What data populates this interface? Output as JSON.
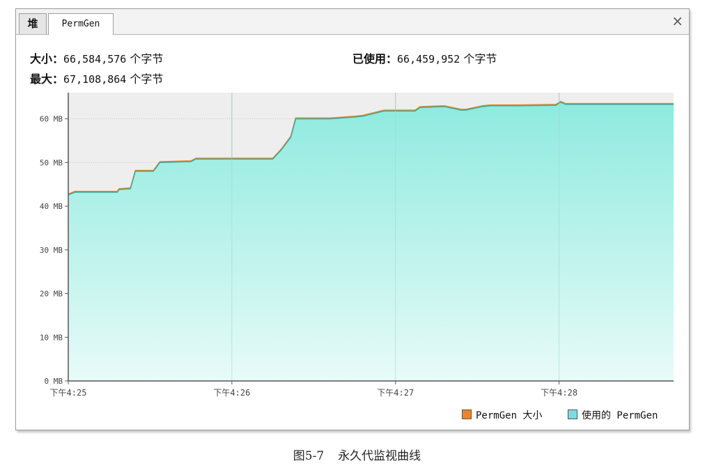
{
  "tabs": [
    {
      "label": "堆",
      "active": false
    },
    {
      "label": "PermGen",
      "active": true
    }
  ],
  "close_label": "×",
  "stats": {
    "size_label": "大小：",
    "size_value": "66,584,576",
    "max_label": "最大：",
    "max_value": "67,108,864",
    "used_label": "已使用：",
    "used_value": "66,459,952",
    "unit": "个字节"
  },
  "chart_data": {
    "type": "area",
    "colors": {
      "size": "#e8862a",
      "used": "#8eeadf",
      "plot_bg": "#eeeeee"
    },
    "y_ticks": [
      "0 MB",
      "10 MB",
      "20 MB",
      "30 MB",
      "40 MB",
      "50 MB",
      "60 MB"
    ],
    "y_tick_values": [
      0,
      10,
      20,
      30,
      40,
      50,
      60
    ],
    "ylim": [
      0,
      66
    ],
    "x_ticks": [
      "下午4:25",
      "下午4:26",
      "下午4:27",
      "下午4:28"
    ],
    "x_tick_values": [
      0,
      1,
      2,
      3
    ],
    "xlim": [
      0,
      3.7
    ],
    "grid": true,
    "series": [
      {
        "name": "PermGen 大小",
        "color": "#e8862a",
        "x": [
          0,
          0.04,
          0.3,
          0.31,
          0.38,
          0.41,
          0.52,
          0.56,
          0.75,
          0.78,
          1.02,
          1.25,
          1.3,
          1.33,
          1.36,
          1.39,
          1.6,
          1.75,
          1.8,
          1.93,
          2.12,
          2.15,
          2.3,
          2.4,
          2.43,
          2.53,
          2.58,
          2.75,
          2.98,
          3.01,
          3.04,
          3.7
        ],
        "y": [
          42.8,
          43.4,
          43.4,
          44,
          44.2,
          48.2,
          48.2,
          50.2,
          50.4,
          51,
          51,
          51,
          53,
          54.5,
          56,
          60.2,
          60.2,
          60.6,
          60.8,
          62,
          62,
          62.8,
          63,
          62.2,
          62.2,
          63,
          63.2,
          63.2,
          63.3,
          64,
          63.5,
          63.5
        ]
      },
      {
        "name": "使用的 PermGen",
        "color": "#8eeadf",
        "x": [
          0,
          0.04,
          0.3,
          0.31,
          0.38,
          0.41,
          0.52,
          0.56,
          0.75,
          0.78,
          1.02,
          1.25,
          1.3,
          1.33,
          1.36,
          1.39,
          1.6,
          1.75,
          1.8,
          1.93,
          2.12,
          2.15,
          2.3,
          2.4,
          2.43,
          2.53,
          2.58,
          2.75,
          2.98,
          3.01,
          3.04,
          3.7
        ],
        "y": [
          42.6,
          43.2,
          43.2,
          43.8,
          44,
          48,
          48,
          50,
          50.2,
          50.8,
          50.8,
          50.8,
          52.8,
          54.3,
          55.8,
          60,
          60,
          60.4,
          60.6,
          61.8,
          61.8,
          62.6,
          62.8,
          62,
          62,
          62.8,
          63,
          63,
          63.1,
          63.8,
          63.3,
          63.3
        ]
      }
    ]
  },
  "legend": {
    "size_label": "PermGen 大小",
    "used_label": "使用的 PermGen"
  },
  "caption": {
    "number": "图5-7",
    "text": "永久代监视曲线"
  }
}
